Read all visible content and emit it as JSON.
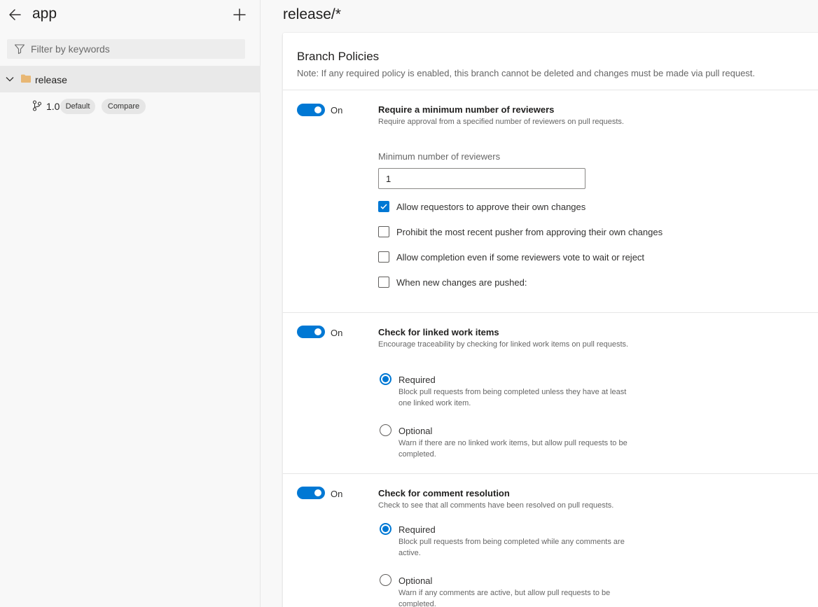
{
  "colors": {
    "accent": "#0078d4",
    "folder": "#e8b774",
    "sidebar_bg": "#f8f8f8"
  },
  "sidebar": {
    "back_icon": "arrow-left-icon",
    "title": "app",
    "add_icon": "plus-icon",
    "filter": {
      "icon": "filter-icon",
      "placeholder": "Filter by keywords"
    },
    "tree": [
      {
        "label": "release",
        "icon": "folder-icon",
        "expanded": true,
        "children": [
          {
            "label": "1.0",
            "icon": "branch-icon",
            "badges": [
              "Default",
              "Compare"
            ]
          }
        ]
      }
    ]
  },
  "main": {
    "title": "release/*",
    "card": {
      "title": "Branch Policies",
      "note": "Note: If any required policy is enabled, this branch cannot be deleted and changes must be made via pull request.",
      "policies": [
        {
          "toggle": "On",
          "title": "Require a minimum number of reviewers",
          "description": "Require approval from a specified number of reviewers on pull requests.",
          "field_label": "Minimum number of reviewers",
          "field_value": "1",
          "options": [
            {
              "label": "Allow requestors to approve their own changes",
              "checked": true
            },
            {
              "label": "Prohibit the most recent pusher from approving their own changes",
              "checked": false
            },
            {
              "label": "Allow completion even if some reviewers vote to wait or reject",
              "checked": false
            },
            {
              "label": "When new changes are pushed:",
              "checked": false
            }
          ]
        },
        {
          "toggle": "On",
          "title": "Check for linked work items",
          "description": "Encourage traceability by checking for linked work items on pull requests.",
          "options": [
            {
              "label": "Required",
              "description": "Block pull requests from being completed unless they have at least one linked work item.",
              "selected": true
            },
            {
              "label": "Optional",
              "description": "Warn if there are no linked work items, but allow pull requests to be completed.",
              "selected": false
            }
          ]
        },
        {
          "toggle": "On",
          "title": "Check for comment resolution",
          "description": "Check to see that all comments have been resolved on pull requests.",
          "options": [
            {
              "label": "Required",
              "description": "Block pull requests from being completed while any comments are active.",
              "selected": true
            },
            {
              "label": "Optional",
              "description": "Warn if any comments are active, but allow pull requests to be completed.",
              "selected": false
            }
          ]
        }
      ]
    }
  }
}
